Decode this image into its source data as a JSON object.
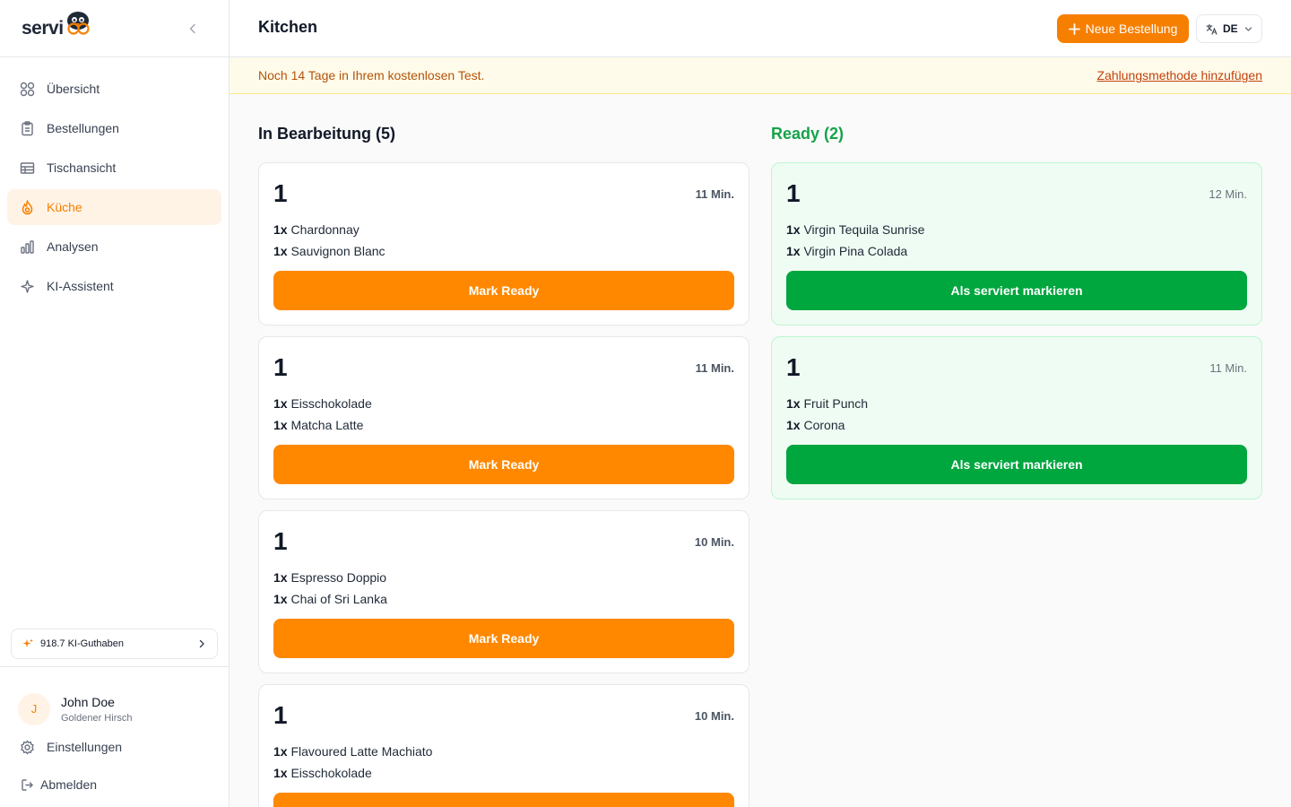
{
  "app": {
    "logo_text": "servi"
  },
  "sidebar": {
    "items": [
      {
        "label": "Übersicht",
        "icon": "grid-icon"
      },
      {
        "label": "Bestellungen",
        "icon": "clipboard-icon"
      },
      {
        "label": "Tischansicht",
        "icon": "table-icon"
      },
      {
        "label": "Küche",
        "icon": "flame-icon",
        "active": true
      },
      {
        "label": "Analysen",
        "icon": "bar-chart-icon"
      },
      {
        "label": "KI-Assistent",
        "icon": "sparkle-icon"
      }
    ],
    "credits_label": "918.7 KI-Guthaben",
    "user": {
      "initial": "J",
      "name": "John Doe",
      "restaurant": "Goldener Hirsch"
    },
    "settings_label": "Einstellungen",
    "logout_label": "Abmelden"
  },
  "header": {
    "title": "Kitchen",
    "new_order_label": "Neue Bestellung",
    "language": "DE"
  },
  "banner": {
    "text": "Noch 14 Tage in Ihrem kostenlosen Test.",
    "link": "Zahlungsmethode hinzufügen"
  },
  "columns": {
    "in_progress": {
      "title": "In Bearbeitung (5)",
      "button_label": "Mark Ready",
      "orders": [
        {
          "number": "1",
          "time": "11 Min.",
          "items": [
            {
              "qty": "1x",
              "name": "Chardonnay"
            },
            {
              "qty": "1x",
              "name": "Sauvignon Blanc"
            }
          ]
        },
        {
          "number": "1",
          "time": "11 Min.",
          "items": [
            {
              "qty": "1x",
              "name": "Eisschokolade"
            },
            {
              "qty": "1x",
              "name": "Matcha Latte"
            }
          ]
        },
        {
          "number": "1",
          "time": "10 Min.",
          "items": [
            {
              "qty": "1x",
              "name": "Espresso Doppio"
            },
            {
              "qty": "1x",
              "name": "Chai of Sri Lanka"
            }
          ]
        },
        {
          "number": "1",
          "time": "10 Min.",
          "items": [
            {
              "qty": "1x",
              "name": "Flavoured Latte Machiato"
            },
            {
              "qty": "1x",
              "name": "Eisschokolade"
            }
          ]
        }
      ]
    },
    "ready": {
      "title": "Ready (2)",
      "button_label": "Als serviert markieren",
      "orders": [
        {
          "number": "1",
          "time": "12 Min.",
          "items": [
            {
              "qty": "1x",
              "name": "Virgin Tequila Sunrise"
            },
            {
              "qty": "1x",
              "name": "Virgin Pina Colada"
            }
          ]
        },
        {
          "number": "1",
          "time": "11 Min.",
          "items": [
            {
              "qty": "1x",
              "name": "Fruit Punch"
            },
            {
              "qty": "1x",
              "name": "Corona"
            }
          ]
        }
      ]
    }
  },
  "colors": {
    "accent": "#ff8800",
    "ready": "#00a63e",
    "ready_title": "#16a34a"
  }
}
